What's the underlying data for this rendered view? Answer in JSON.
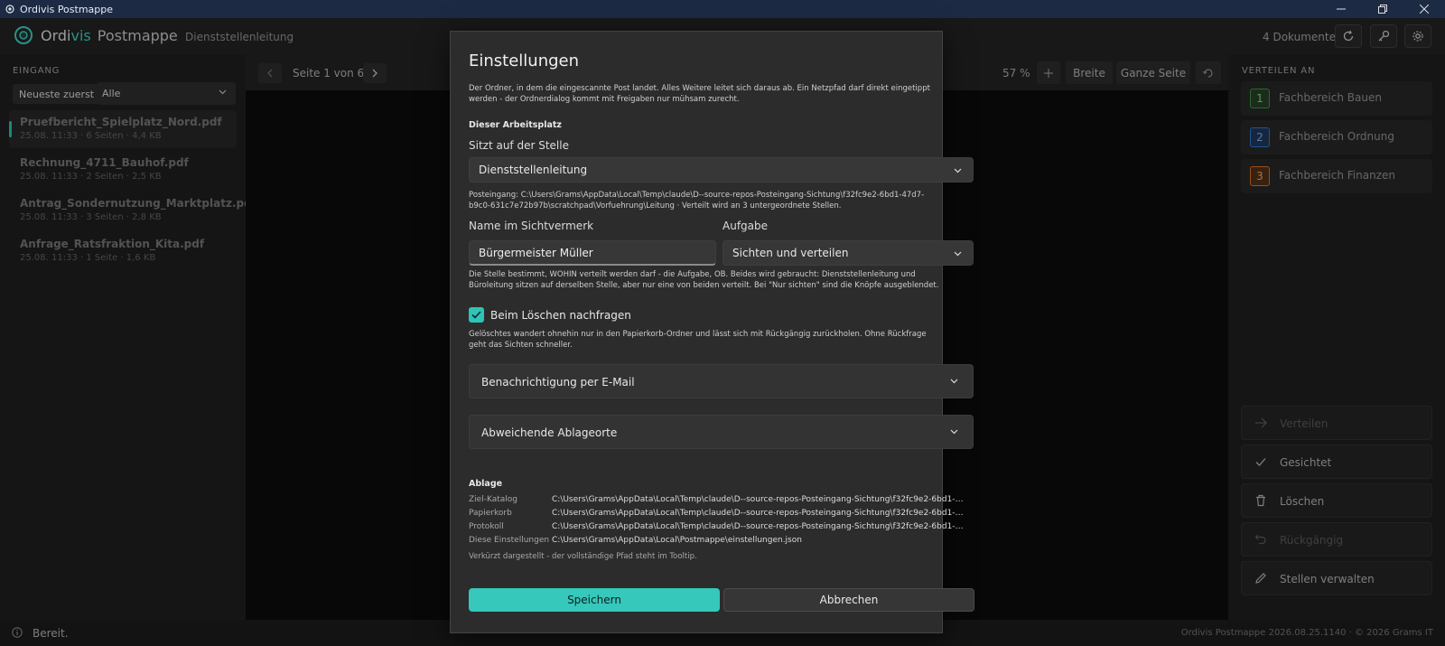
{
  "titlebar": {
    "title": "Ordivis Postmappe"
  },
  "header": {
    "brand_part1": "Ordi",
    "brand_part2": "vis",
    "brand_part3": "Postmappe",
    "subtitle": "Dienststellenleitung",
    "doc_count": "4 Dokumente"
  },
  "left": {
    "heading": "EINGANG",
    "sort_label": "Neueste zuerst",
    "filter_value": "Alle",
    "files": [
      {
        "name": "Pruefbericht_Spielplatz_Nord.pdf",
        "meta": "25.08. 11:33 · 6 Seiten · 4,4 KB"
      },
      {
        "name": "Rechnung_4711_Bauhof.pdf",
        "meta": "25.08. 11:33 · 2 Seiten · 2,5 KB"
      },
      {
        "name": "Antrag_Sondernutzung_Marktplatz.pdf",
        "meta": "25.08. 11:33 · 3 Seiten · 2,8 KB"
      },
      {
        "name": "Anfrage_Ratsfraktion_Kita.pdf",
        "meta": "25.08. 11:33 · 1 Seite · 1,6 KB"
      }
    ]
  },
  "viewer": {
    "page_label": "Seite 1 von 6",
    "zoom": "57 %",
    "fit_width": "Breite",
    "fit_page": "Ganze Seite"
  },
  "right": {
    "heading": "VERTEILEN AN",
    "departments": [
      {
        "num": "1",
        "label": "Fachbereich Bauen",
        "color": "#3a8a3a"
      },
      {
        "num": "2",
        "label": "Fachbereich Ordnung",
        "color": "#2a6fc9"
      },
      {
        "num": "3",
        "label": "Fachbereich Finanzen",
        "color": "#d06a1e"
      }
    ],
    "actions": {
      "distribute": "Verteilen",
      "viewed": "Gesichtet",
      "delete": "Löschen",
      "undo": "Rückgängig",
      "manage": "Stellen verwalten"
    }
  },
  "status": {
    "text": "Bereit.",
    "footer": "Ordivis Postmappe 2026.08.25.1140 · © 2026 Grams IT"
  },
  "dialog": {
    "title": "Einstellungen",
    "intro": "Der Ordner, in dem die eingescannte Post landet. Alles Weitere leitet sich daraus ab. Ein Netzpfad darf direkt eingetippt werden - der Ordnerdialog kommt mit Freigaben nur mühsam zurecht.",
    "section_workplace": "Dieser Arbeitsplatz",
    "post_label": "Sitzt auf der Stelle",
    "post_value": "Dienststellenleitung",
    "inbox_info": "Posteingang: C:\\Users\\Grams\\AppData\\Local\\Temp\\claude\\D--source-repos-Posteingang-Sichtung\\f32fc9e2-6bd1-47d7-b9c0-631c7e72b97b\\scratchpad\\Vorfuehrung\\Leitung · Verteilt wird an 3 untergeordnete Stellen.",
    "name_label": "Name im Sichtvermerk",
    "name_value": "Bürgermeister Müller",
    "task_label": "Aufgabe",
    "task_value": "Sichten und verteilen",
    "task_info": "Die Stelle bestimmt, WOHIN verteilt werden darf - die Aufgabe, OB. Beides wird gebraucht: Dienststellenleitung und Büroleitung sitzen auf derselben Stelle, aber nur eine von beiden verteilt. Bei \"Nur sichten\" sind die Knöpfe ausgeblendet.",
    "confirm_delete_label": "Beim Löschen nachfragen",
    "confirm_delete_info": "Gelöschtes wandert ohnehin nur in den Papierkorb-Ordner und lässt sich mit Rückgängig zurückholen. Ohne Rückfrage geht das Sichten schneller.",
    "expander_email": "Benachrichtigung per E-Mail",
    "expander_locations": "Abweichende Ablageorte",
    "section_storage": "Ablage",
    "storage": [
      {
        "key": "Ziel-Katalog",
        "value": "C:\\Users\\Grams\\AppData\\Local\\Temp\\claude\\D--source-repos-Posteingang-Sichtung\\f32fc9e2-6bd1-47d7-..."
      },
      {
        "key": "Papierkorb",
        "value": "C:\\Users\\Grams\\AppData\\Local\\Temp\\claude\\D--source-repos-Posteingang-Sichtung\\f32fc9e2-6bd1-47d7-..."
      },
      {
        "key": "Protokoll",
        "value": "C:\\Users\\Grams\\AppData\\Local\\Temp\\claude\\D--source-repos-Posteingang-Sichtung\\f32fc9e2-6bd1-47d7-..."
      },
      {
        "key": "Diese Einstellungen",
        "value": "C:\\Users\\Grams\\AppData\\Local\\Postmappe\\einstellungen.json"
      }
    ],
    "storage_note": "Verkürzt dargestellt - der vollständige Pfad steht im Tooltip.",
    "save_label": "Speichern",
    "cancel_label": "Abbrechen"
  },
  "colors": {
    "accent": "#35c8bb",
    "titlebar": "#1d2a44"
  }
}
